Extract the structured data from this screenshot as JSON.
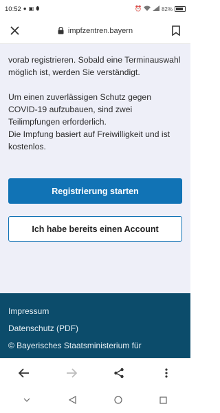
{
  "status_bar": {
    "time": "10:52",
    "battery_percent": "82%",
    "battery_level": 0.82
  },
  "browser": {
    "url": "impfzentren.bayern"
  },
  "content": {
    "paragraph1": "vorab registrieren. Sobald eine Terminauswahl möglich ist, werden Sie verständigt.",
    "paragraph2_line1": "Um einen zuverlässigen Schutz gegen COVID-19 aufzubauen, sind zwei Teilimpfungen erforderlich.",
    "paragraph2_line2": "Die Impfung basiert auf Freiwilligkeit und ist kostenlos.",
    "primary_button": "Registrierung starten",
    "secondary_button": "Ich habe bereits einen Account"
  },
  "footer": {
    "links": [
      "Impressum",
      "Datenschutz (PDF)"
    ],
    "copyright": "© Bayerisches Staatsministerium für"
  },
  "colors": {
    "primary": "#1173b5",
    "footer_bg": "#0c4c6b",
    "content_bg": "#eeeff8"
  }
}
